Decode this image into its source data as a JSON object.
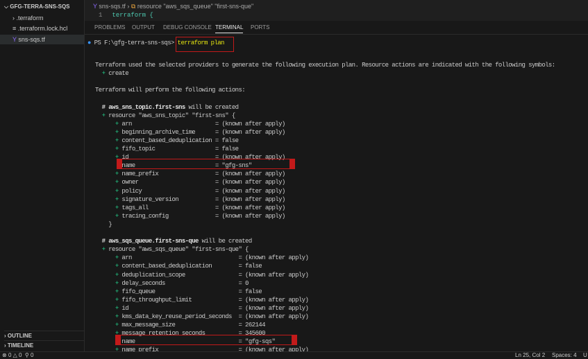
{
  "sidebar": {
    "project": "GFG-TERRA-SNS-SQS",
    "files": [
      ".terraform",
      ".terraform.lock.hcl",
      "sns-sqs.tf"
    ],
    "outline": "OUTLINE",
    "timeline": "TIMELINE"
  },
  "editor": {
    "breadcrumb_file": "sns-sqs.tf",
    "breadcrumb_symbol": "resource \"aws_sqs_queue\" \"first-sns-que\"",
    "line_no": "1",
    "line_code": "terraform {"
  },
  "panel_tabs": [
    "PROBLEMS",
    "OUTPUT",
    "DEBUG CONSOLE",
    "TERMINAL",
    "PORTS"
  ],
  "terminal": {
    "prompt": "PS F:\\gfg-terra-sns-sqs>",
    "command": "terraform plan",
    "intro": "Terraform used the selected providers to generate the following execution plan. Resource actions are indicated with the following symbols:",
    "create": "create",
    "perform": "Terraform will perform the following actions:",
    "blocks": [
      {
        "header": "aws_sns_topic.first-sns",
        "header_suffix": " will be created",
        "resource": "resource \"aws_sns_topic\" \"first-sns\" {",
        "pad": 28,
        "attrs": [
          [
            "arn",
            "(known after apply)"
          ],
          [
            "beginning_archive_time",
            "(known after apply)"
          ],
          [
            "content_based_deduplication",
            "false"
          ],
          [
            "fifo_topic",
            "false"
          ],
          [
            "id",
            "(known after apply)"
          ],
          [
            "name",
            "\"gfg-sns\""
          ],
          [
            "name_prefix",
            "(known after apply)"
          ],
          [
            "owner",
            "(known after apply)"
          ],
          [
            "policy",
            "(known after apply)"
          ],
          [
            "signature_version",
            "(known after apply)"
          ],
          [
            "tags_all",
            "(known after apply)"
          ],
          [
            "tracing_config",
            "(known after apply)"
          ]
        ]
      },
      {
        "header": "aws_sqs_queue.first-sns-que",
        "header_suffix": " will be created",
        "resource": "resource \"aws_sqs_queue\" \"first-sns-que\" {",
        "pad": 35,
        "attrs": [
          [
            "arn",
            "(known after apply)"
          ],
          [
            "content_based_deduplication",
            "false"
          ],
          [
            "deduplication_scope",
            "(known after apply)"
          ],
          [
            "delay_seconds",
            "0"
          ],
          [
            "fifo_queue",
            "false"
          ],
          [
            "fifo_throughput_limit",
            "(known after apply)"
          ],
          [
            "id",
            "(known after apply)"
          ],
          [
            "kms_data_key_reuse_period_seconds",
            "(known after apply)"
          ],
          [
            "max_message_size",
            "262144"
          ],
          [
            "message_retention_seconds",
            "345600"
          ],
          [
            "name",
            "\"gfg-sqs\""
          ],
          [
            "name_prefix",
            "(known after apply)"
          ]
        ]
      }
    ]
  },
  "status": {
    "errors": "0",
    "warnings": "0",
    "ports": "0",
    "position": "Ln 25, Col 2",
    "spaces": "Spaces: 4",
    "encoding": "U"
  },
  "colors": {
    "highlight": "#c21a1a",
    "plus": "#23d18b",
    "command": "#e5e510"
  }
}
